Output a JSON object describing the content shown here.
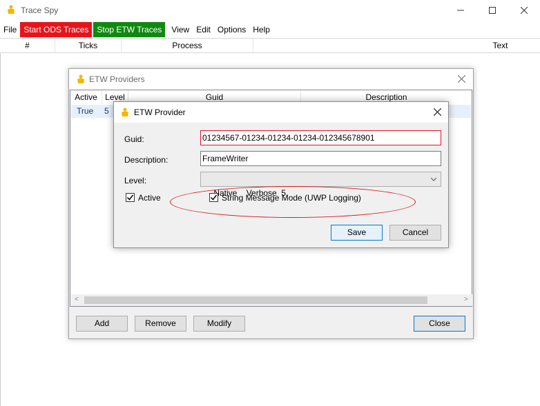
{
  "window": {
    "title": "Trace Spy",
    "controls": {
      "minimize": "–",
      "maximize": "☐",
      "close": "✕"
    }
  },
  "menu": {
    "items": [
      {
        "label": "File"
      },
      {
        "label": "Start ODS Traces",
        "color": "#e8141b"
      },
      {
        "label": "Stop ETW Traces",
        "color": "#0f8a10"
      },
      {
        "label": "View"
      },
      {
        "label": "Edit"
      },
      {
        "label": "Options"
      },
      {
        "label": "Help"
      }
    ]
  },
  "grid": {
    "columns": [
      "#",
      "Ticks",
      "Process",
      "Text"
    ]
  },
  "providers_dialog": {
    "title": "ETW Providers",
    "close": "✕",
    "columns": [
      "Active",
      "Level",
      "Guid",
      "Description"
    ],
    "rows": [
      {
        "active": "True",
        "level": "5"
      }
    ],
    "buttons": {
      "add": "Add",
      "remove": "Remove",
      "modify": "Modify",
      "close": "Close"
    }
  },
  "provider_dialog": {
    "title": "ETW Provider",
    "close": "✕",
    "guid_label": "Guid:",
    "guid_value": "01234567-01234-01234-01234-012345678901",
    "description_label": "Description:",
    "description_value": "FrameWriter",
    "level_label": "Level:",
    "level_value": "Native    Verbose  5",
    "active_label": "Active",
    "active_checked": true,
    "string_mode_label": "String Message Mode (UWP Logging)",
    "string_mode_checked": true,
    "save": "Save",
    "cancel": "Cancel"
  },
  "colors": {
    "highlight_ellipse": "#d6161b",
    "default_button_border": "#0078d7"
  }
}
